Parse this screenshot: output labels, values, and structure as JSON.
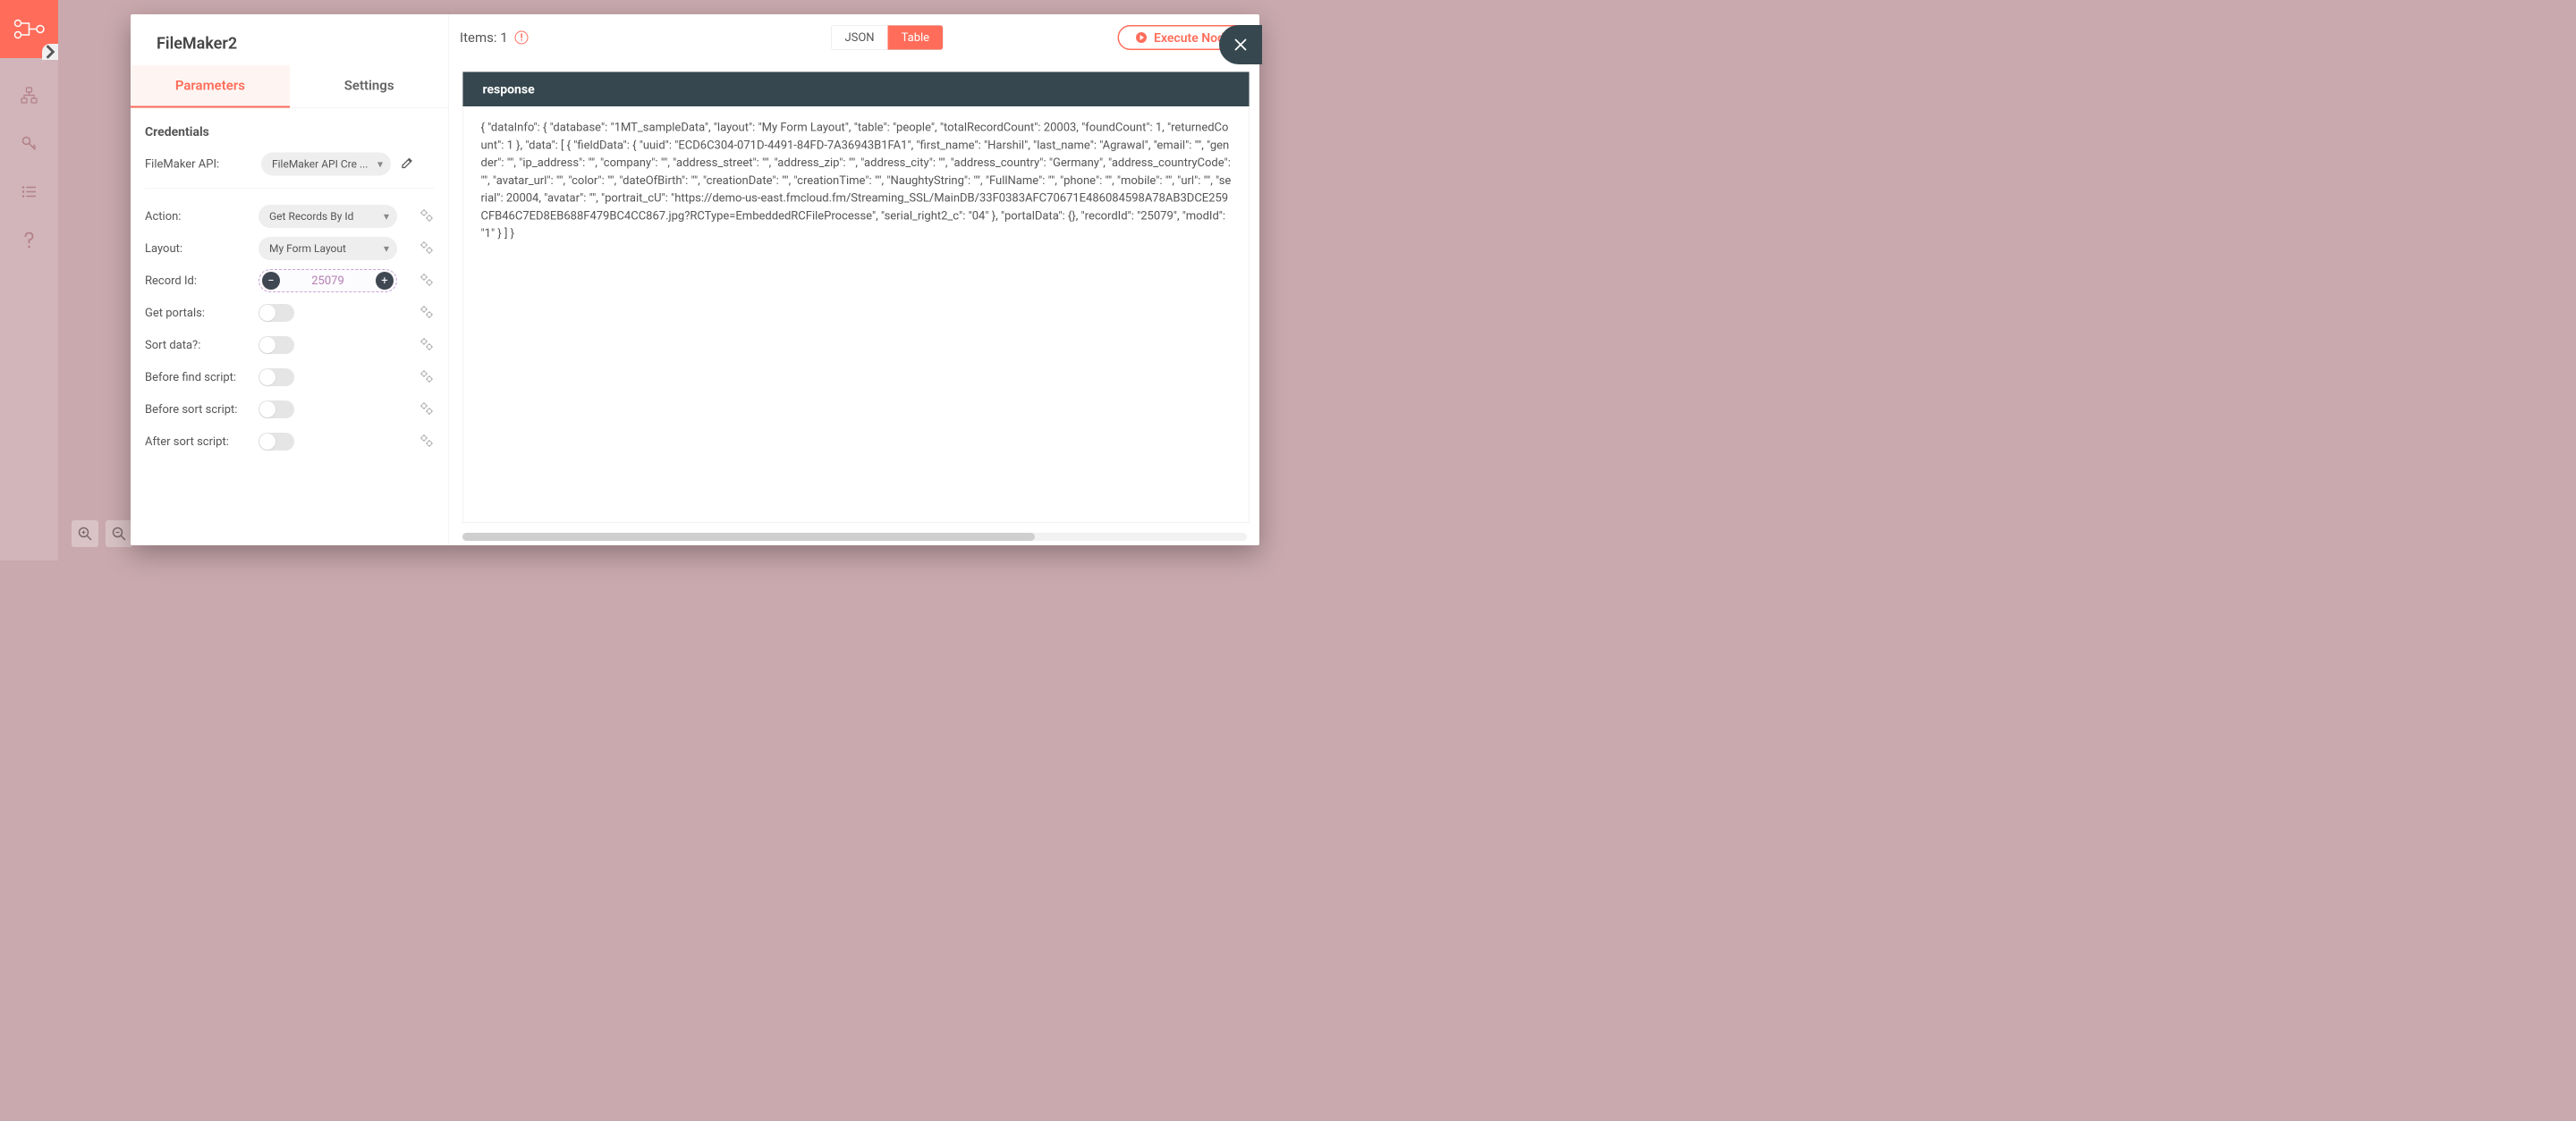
{
  "sidebar": {
    "icons": [
      "workflow-icon",
      "key-icon",
      "list-icon",
      "help-icon"
    ]
  },
  "modal": {
    "title": "FileMaker2",
    "tabs": {
      "parameters": "Parameters",
      "settings": "Settings",
      "active": "parameters"
    },
    "credentials": {
      "heading": "Credentials",
      "api_label": "FileMaker API:",
      "api_value": "FileMaker API Cre  ..."
    },
    "params": {
      "action": {
        "label": "Action:",
        "value": "Get Records By Id"
      },
      "layout": {
        "label": "Layout:",
        "value": "My Form Layout"
      },
      "record_id": {
        "label": "Record Id:",
        "value": "25079"
      },
      "get_portals": {
        "label": "Get portals:",
        "value": false
      },
      "sort_data": {
        "label": "Sort data?:",
        "value": false
      },
      "before_find": {
        "label": "Before find script:",
        "value": false
      },
      "before_sort": {
        "label": "Before sort script:",
        "value": false
      },
      "after_sort": {
        "label": "After sort script:",
        "value": false
      }
    }
  },
  "output": {
    "items_label": "Items: 1",
    "view_json": "JSON",
    "view_table": "Table",
    "execute_label": "Execute Node",
    "response_heading": "response",
    "response_body": "{ \"dataInfo\": { \"database\": \"1MT_sampleData\", \"layout\": \"My Form Layout\", \"table\": \"people\", \"totalRecordCount\": 20003, \"foundCount\": 1, \"returnedCount\": 1 }, \"data\": [ { \"fieldData\": { \"uuid\": \"ECD6C304-071D-4491-84FD-7A36943B1FA1\", \"first_name\": \"Harshil\", \"last_name\": \"Agrawal\", \"email\": \"\", \"gender\": \"\", \"ip_address\": \"\", \"company\": \"\", \"address_street\": \"\", \"address_zip\": \"\", \"address_city\": \"\", \"address_country\": \"Germany\", \"address_countryCode\": \"\", \"avatar_url\": \"\", \"color\": \"\", \"dateOfBirth\": \"\", \"creationDate\": \"\", \"creationTime\": \"\", \"NaughtyString\": \"\", \"FullName\": \"\", \"phone\": \"\", \"mobile\": \"\", \"url\": \"\", \"serial\": 20004, \"avatar\": \"\", \"portrait_cU\": \"https://demo-us-east.fmcloud.fm/Streaming_SSL/MainDB/33F0383AFC70671E486084598A78AB3DCE259CFB46C7ED8EB688F479BC4CC867.jpg?RCType=EmbeddedRCFileProcesse\", \"serial_right2_c\": \"04\" }, \"portalData\": {}, \"recordId\": \"25079\", \"modId\": \"1\" } ] }"
  }
}
